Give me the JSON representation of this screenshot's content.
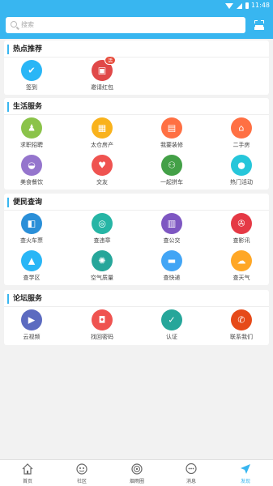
{
  "status_bar": {
    "time": "11:48"
  },
  "search": {
    "placeholder": "搜索"
  },
  "sections": {
    "hot": {
      "title": "热点推荐",
      "items": [
        {
          "label": "签到",
          "icon": "checkin-icon",
          "color": "#29b6f6"
        },
        {
          "label": "邀请红包",
          "icon": "red-envelope-icon",
          "color": "#e04848",
          "badge": "活"
        }
      ]
    },
    "life": {
      "title": "生活服务",
      "items": [
        {
          "label": "求职招聘",
          "icon": "job-seeker-icon",
          "color": "#8bc34a"
        },
        {
          "label": "太仓房产",
          "icon": "building-icon",
          "color": "#f9b21c"
        },
        {
          "label": "我要装修",
          "icon": "paint-roller-icon",
          "color": "#ff7043"
        },
        {
          "label": "二手房",
          "icon": "house-icon",
          "color": "#ff7043"
        },
        {
          "label": "美食餐饮",
          "icon": "food-bowl-icon",
          "color": "#9575cd"
        },
        {
          "label": "交友",
          "icon": "heart-icon",
          "color": "#ef5350"
        },
        {
          "label": "一起拼车",
          "icon": "carpool-icon",
          "color": "#43a047"
        },
        {
          "label": "热门活动",
          "icon": "balloons-icon",
          "color": "#26c6da"
        }
      ]
    },
    "query": {
      "title": "便民查询",
      "items": [
        {
          "label": "查火车票",
          "icon": "train-icon",
          "color": "#2a8fd8"
        },
        {
          "label": "查违章",
          "icon": "violation-search-icon",
          "color": "#26b5a5"
        },
        {
          "label": "查公交",
          "icon": "bus-icon",
          "color": "#7e57c2"
        },
        {
          "label": "查影讯",
          "icon": "film-reel-icon",
          "color": "#e53945"
        },
        {
          "label": "查学区",
          "icon": "graduation-cap-icon",
          "color": "#29b6f6"
        },
        {
          "label": "空气质量",
          "icon": "air-quality-icon",
          "color": "#26a69a"
        },
        {
          "label": "查快递",
          "icon": "delivery-truck-icon",
          "color": "#42a5f5"
        },
        {
          "label": "查天气",
          "icon": "weather-icon",
          "color": "#ffa726"
        }
      ]
    },
    "forum": {
      "title": "论坛服务",
      "items": [
        {
          "label": "云视频",
          "icon": "video-play-icon",
          "color": "#5c6bc0"
        },
        {
          "label": "找回密码",
          "icon": "lock-icon",
          "color": "#ef5350"
        },
        {
          "label": "认证",
          "icon": "shield-check-icon",
          "color": "#26a69a"
        },
        {
          "label": "联系我们",
          "icon": "phone-chat-icon",
          "color": "#e64a19"
        }
      ]
    }
  },
  "tabbar": [
    {
      "label": "首页",
      "icon": "home-icon",
      "active": false
    },
    {
      "label": "社区",
      "icon": "community-icon",
      "active": false
    },
    {
      "label": "烟雨圈",
      "icon": "circle-icon",
      "active": false
    },
    {
      "label": "消息",
      "icon": "message-icon",
      "active": false
    },
    {
      "label": "发现",
      "icon": "discover-icon",
      "active": true
    }
  ],
  "colors": {
    "accent": "#38b6f0"
  }
}
